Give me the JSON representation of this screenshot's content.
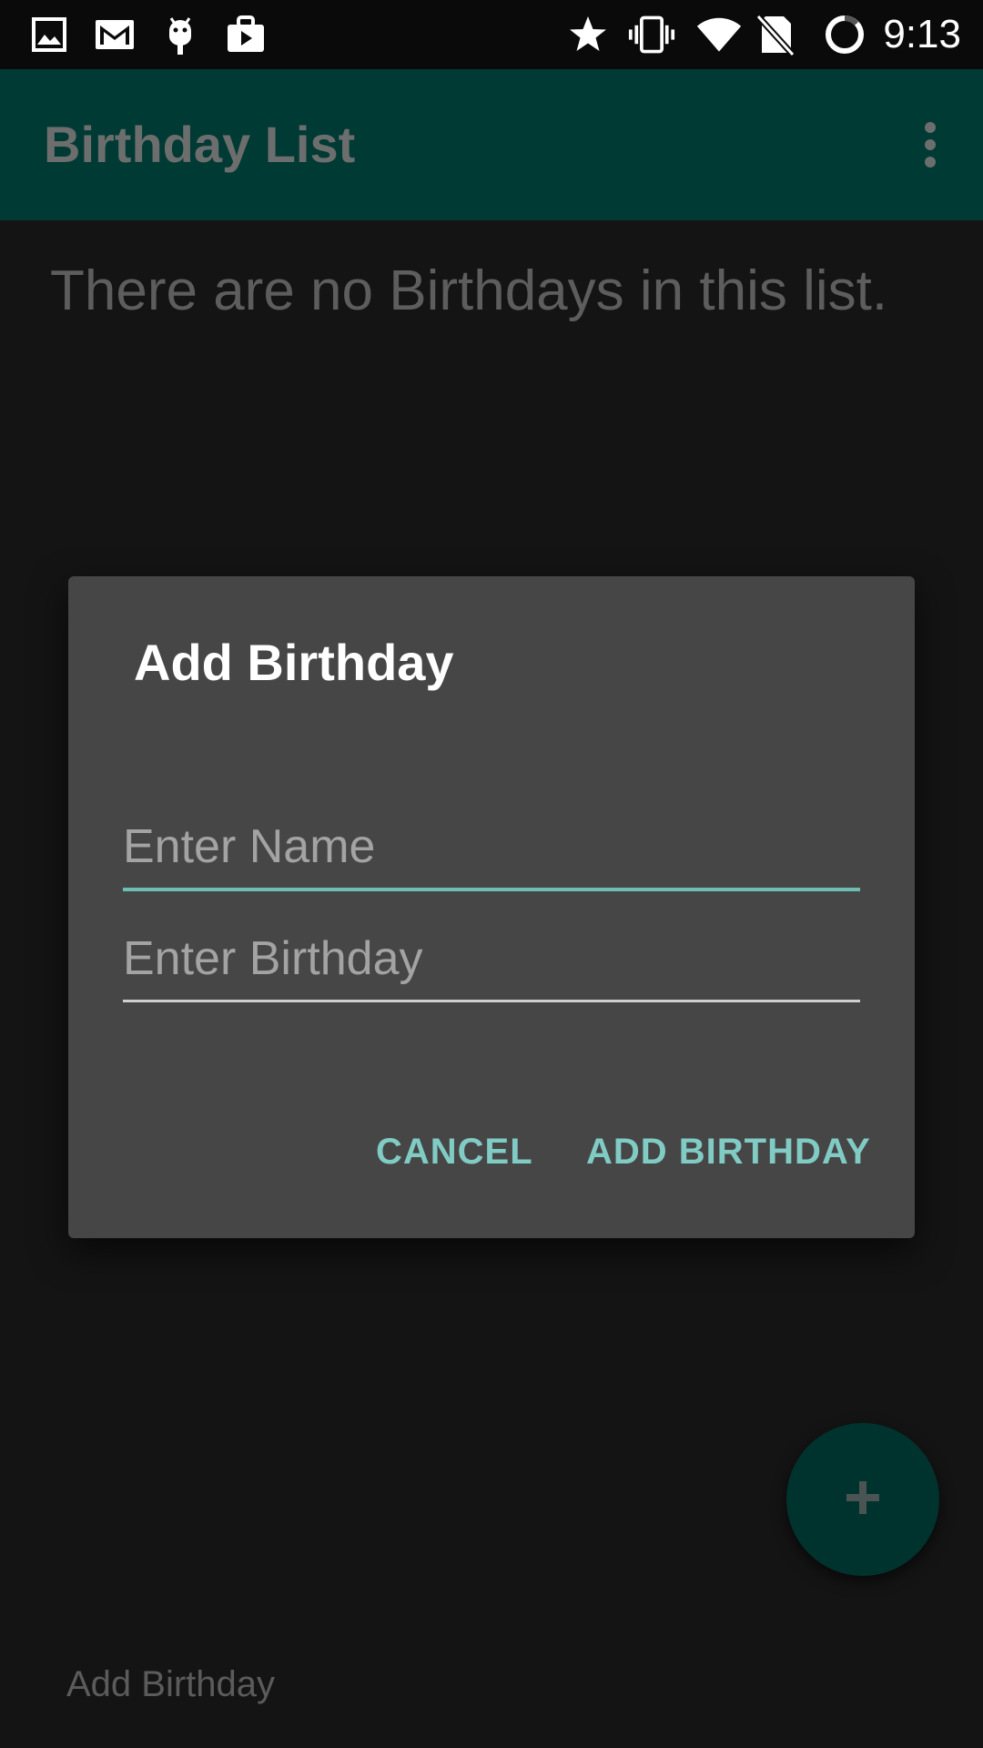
{
  "status_bar": {
    "time": "9:13",
    "left_icons": [
      "image-icon",
      "gmail-icon",
      "android-icon",
      "play-store-icon"
    ],
    "right_icons": [
      "star-icon",
      "vibrate-icon",
      "wifi-icon",
      "no-sim-icon",
      "battery-ring-icon"
    ]
  },
  "app_bar": {
    "title": "Birthday List",
    "overflow_icon": "more-vert-icon"
  },
  "main": {
    "empty_message": "There are no Birthdays in this list.",
    "footer_label": "Add Birthday",
    "fab_icon": "plus-icon"
  },
  "dialog": {
    "title": "Add Birthday",
    "name_field": {
      "value": "",
      "placeholder": "Enter Name"
    },
    "birthday_field": {
      "value": "",
      "placeholder": "Enter Birthday"
    },
    "cancel_label": "CANCEL",
    "confirm_label": "ADD BIRTHDAY"
  },
  "colors": {
    "app_bar_dimmed": "#003a34",
    "accent": "#80cbc4",
    "dialog_bg": "#464646",
    "background": "#141414"
  }
}
